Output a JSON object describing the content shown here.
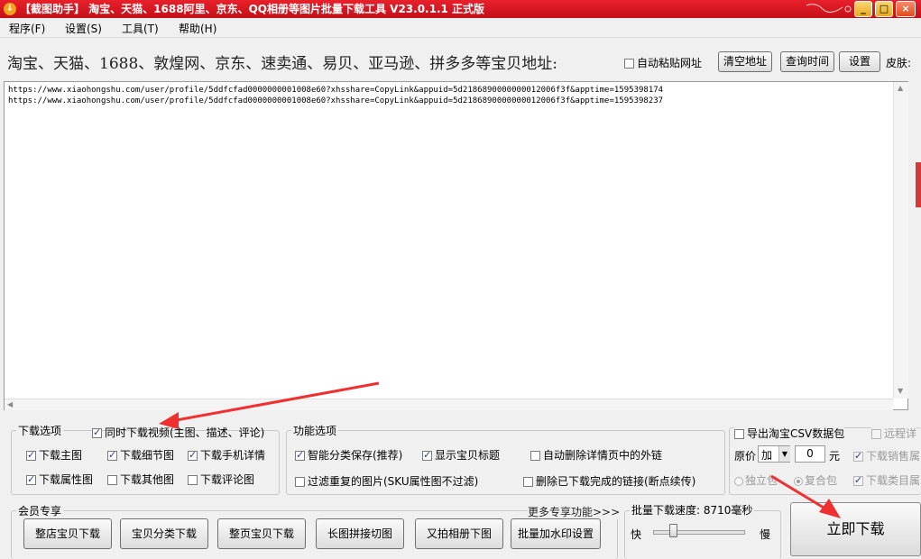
{
  "window": {
    "title": "【截图助手】 淘宝、天猫、1688阿里、京东、QQ相册等图片批量下载工具 V23.0.1.1 正式版",
    "minimize": "_",
    "maximize": "□",
    "close": "×"
  },
  "menu": [
    "程序(F)",
    "设置(S)",
    "工具(T)",
    "帮助(H)"
  ],
  "address": {
    "label": "淘宝、天猫、1688、敦煌网、京东、速卖通、易贝、亚马逊、拼多多等宝贝地址:",
    "auto_paste_label": "自动粘贴网址",
    "clear_button": "清空地址",
    "query_time_button": "查询时间",
    "settings_button": "设置",
    "skin_label": "皮肤:",
    "urls": [
      "https://www.xiaohongshu.com/user/profile/5ddfcfad0000000001008e60?xhsshare=CopyLink&appuid=5d2186890000000012006f3f&apptime=1595398174",
      "https://www.xiaohongshu.com/user/profile/5ddfcfad0000000001008e60?xhsshare=CopyLink&appuid=5d2186890000000012006f3f&apptime=1595398237"
    ]
  },
  "download_options": {
    "title": "下载选项",
    "video": "同时下载视频(主图、描述、评论)",
    "main_image": "下载主图",
    "detail_image": "下载细节图",
    "mobile_detail": "下载手机详情",
    "attr_image": "下载属性图",
    "other_image": "下载其他图",
    "review_image": "下载评论图"
  },
  "function_options": {
    "title": "功能选项",
    "smart_save": "智能分类保存(推荐)",
    "show_title": "显示宝贝标题",
    "auto_delete_links": "自动删除详情页中的外链",
    "filter_dup": "过滤重复的图片(SKU属性图不过滤)",
    "delete_done": "删除已下载完成的链接(断点续传)"
  },
  "csv_options": {
    "export_csv": "导出淘宝CSV数据包",
    "remote": "远程详",
    "price_label": "原价",
    "price_mode": "加",
    "price_value": "0",
    "price_unit": "元",
    "download_sales": "下载销售属",
    "standalone": "独立包",
    "combined": "复合包",
    "download_category": "下载类目属"
  },
  "member": {
    "title": "会员专享",
    "more": "更多专享功能>>>",
    "buttons": [
      "整店宝贝下载",
      "宝贝分类下载",
      "整页宝贝下载",
      "长图拼接切图",
      "又拍相册下图",
      "批量加水印设置"
    ]
  },
  "speed": {
    "label": "批量下载速度:",
    "value": "8710毫秒",
    "fast": "快",
    "slow": "慢",
    "level": 0.22
  },
  "download_now": "立即下载",
  "colors": {
    "title_bar": "#d4141e",
    "arrow": "#f03030"
  }
}
